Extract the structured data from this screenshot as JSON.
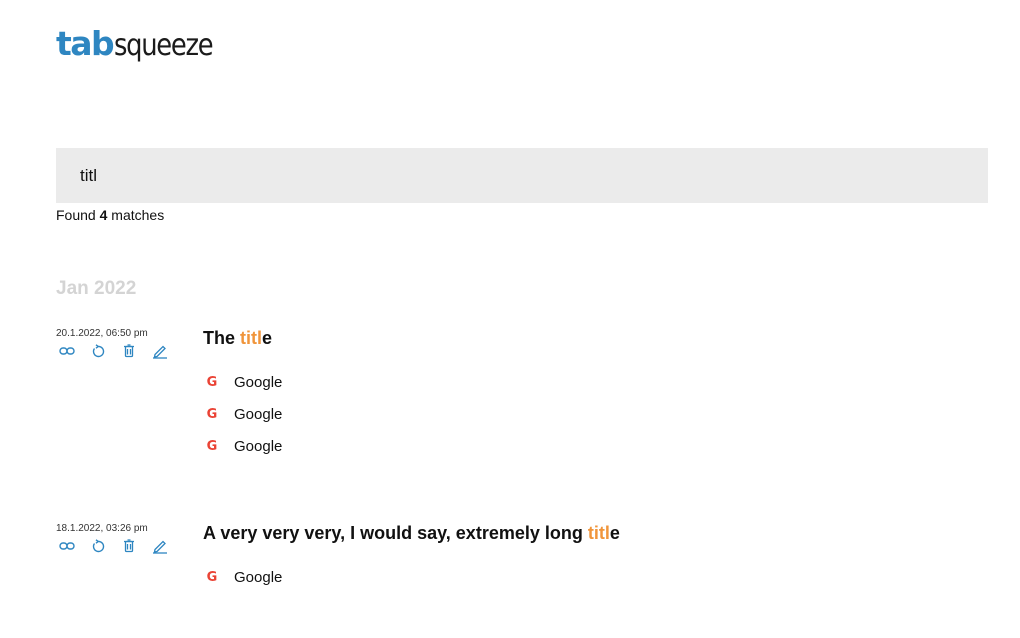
{
  "brand": {
    "part1": "tab",
    "part2": "squeeze",
    "accent": "#2e86c1"
  },
  "search": {
    "value": "titl",
    "placeholder": ""
  },
  "results": {
    "prefix": "Found",
    "count": "4",
    "suffix": "matches"
  },
  "highlight_color": "#f0953b",
  "groups": [
    {
      "label": "Jan 2022",
      "sessions": [
        {
          "date": "20.1.2022, 06:50 pm",
          "title_before": "The ",
          "title_match": "titl",
          "title_after": "e",
          "actions": [
            "link-icon",
            "restore-icon",
            "trash-icon",
            "edit-icon"
          ],
          "tabs": [
            {
              "favicon": "google-icon",
              "label": "Google"
            },
            {
              "favicon": "google-icon",
              "label": "Google"
            },
            {
              "favicon": "google-icon",
              "label": "Google"
            }
          ]
        },
        {
          "date": "18.1.2022, 03:26 pm",
          "title_before": "A very very very, I would say, extremely long ",
          "title_match": "titl",
          "title_after": "e",
          "actions": [
            "link-icon",
            "restore-icon",
            "trash-icon",
            "edit-icon"
          ],
          "tabs": [
            {
              "favicon": "google-icon",
              "label": "Google"
            }
          ]
        }
      ]
    }
  ]
}
